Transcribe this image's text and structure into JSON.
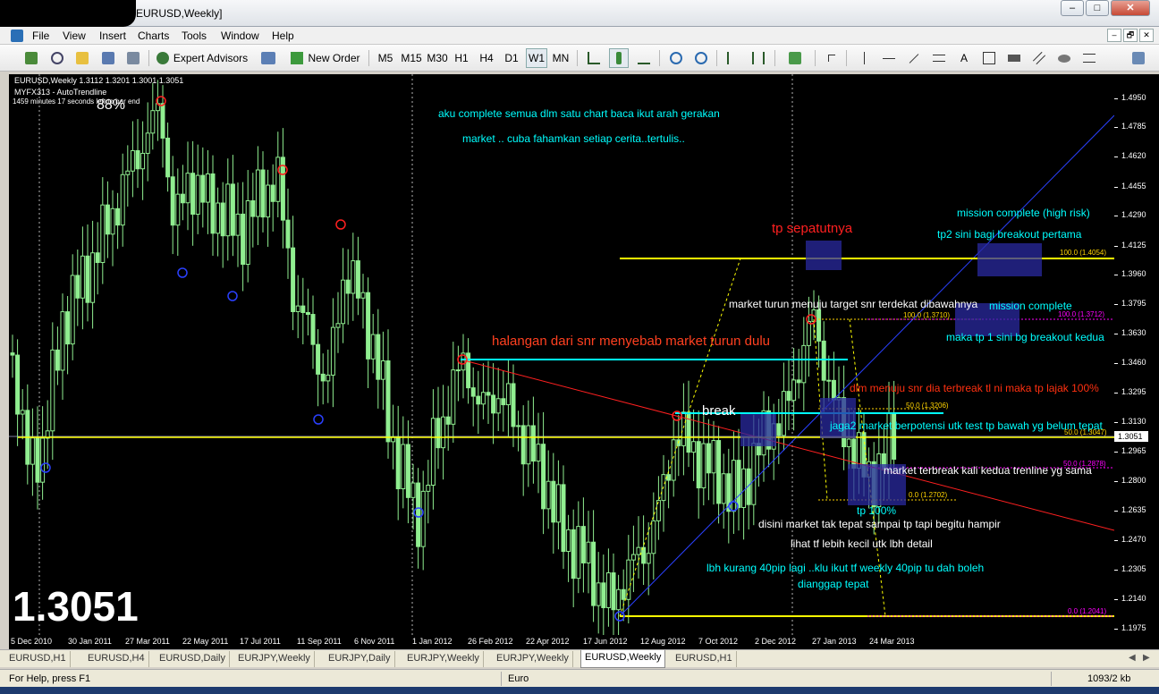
{
  "window": {
    "title": "EURUSD,Weekly]",
    "min": "–",
    "max": "□",
    "close": "✕"
  },
  "menu": {
    "items": [
      "File",
      "View",
      "Insert",
      "Charts",
      "Tools",
      "Window",
      "Help"
    ]
  },
  "mdi": {
    "min": "–",
    "restore": "🗗",
    "close": "✕"
  },
  "toolbar": {
    "expert_advisors": "Expert Advisors",
    "new_order": "New Order",
    "timeframes": [
      "M5",
      "M15",
      "M30",
      "H1",
      "H4",
      "D1",
      "W1",
      "MN"
    ],
    "active_timeframe": "W1",
    "text_tool": "A"
  },
  "chart": {
    "symbol_line": "EURUSD,Weekly  1.3112 1.3201 1.3001 1.3051",
    "indicator": "MYFX313 - AutoTrendline",
    "timer": "1459 minutes 17 seconds left to bar end",
    "percent": "88%",
    "big_price": "1.3051",
    "price_ticks": [
      "1.4950",
      "1.4785",
      "1.4620",
      "1.4455",
      "1.4290",
      "1.4125",
      "1.3960",
      "1.3795",
      "1.3630",
      "1.3460",
      "1.3295",
      "1.3130",
      "1.2965",
      "1.2800",
      "1.2635",
      "1.2470",
      "1.2305",
      "1.2140",
      "1.1975"
    ],
    "current_price": "1.3051",
    "time_ticks": [
      "5 Dec 2010",
      "30 Jan 2011",
      "27 Mar 2011",
      "22 May 2011",
      "17 Jul 2011",
      "11 Sep 2011",
      "6 Nov 2011",
      "1 Jan 2012",
      "26 Feb 2012",
      "22 Apr 2012",
      "17 Jun 2012",
      "12 Aug 2012",
      "7 Oct 2012",
      "2 Dec 2012",
      "27 Jan 2013",
      "24 Mar 2013"
    ],
    "fib_labels": {
      "f1_100": "100.0 (1.4054)",
      "f2_100": "100.0 (1.3710)",
      "f2_50": "50.0 (1.3206)",
      "f2_0": "0.0 (1.2702)",
      "f3_100": "100.0 (1.3712)",
      "f3_50": "50.0 (1.3047)",
      "f3_50b": "50.0 (1.2878)",
      "f3_0": "0.0 (1.2041)"
    },
    "annotations": {
      "a1": "aku complete semua dlm satu chart baca ikut arah gerakan",
      "a2": "market .. cuba fahamkan setiap cerita..tertulis..",
      "tp_sepatutnya": "tp sepatutnya",
      "mission_high": "mission complete (high risk)",
      "tp2": "tp2 sini bagi breakout pertama",
      "market_turun": "market turun menuju target snr terdekat dibawahnya",
      "mission": "mission complete",
      "halangan": "halangan dari snr menyebab market turun dulu",
      "maka_tp1": "maka tp 1 sini bg breakout kedua",
      "dlm_menuju": "dlm menuju snr dia terbreak tl ni maka tp lajak 100%",
      "break": "break",
      "jaga2": "jaga2 market berpotensi utk test tp bawah yg belum tepat",
      "terbreak2": "market terbreak kali kedua trenline yg sama",
      "tp100": "tp 100%",
      "disini": "disini market tak tepat sampai tp tapi begitu hampir",
      "lihat": "lihat tf lebih kecil utk lbh detail",
      "lbh1": "lbh kurang 40pip lagi ..klu ikut tf weekly 40pip tu dah boleh",
      "lbh2": "dianggap tepat"
    }
  },
  "tabs": {
    "items": [
      "EURUSD,H1",
      "EURUSD,H4",
      "EURUSD,Daily",
      "EURJPY,Weekly",
      "EURJPY,Daily",
      "EURJPY,Weekly",
      "EURJPY,Weekly",
      "EURUSD,Weekly",
      "EURUSD,H1"
    ],
    "active": "EURUSD,Weekly",
    "prev": "◀",
    "next": "▶"
  },
  "status": {
    "help": "For Help, press F1",
    "profile": "Euro",
    "traffic": "1093/2 kb"
  },
  "colors": {
    "bull": "#90ee90",
    "bear": "#90ee90",
    "cyan": "#00ffff",
    "yellow": "#ffff00",
    "red": "#ff0000",
    "blue": "#0000ff",
    "magenta": "#ff00ff",
    "fibyellow": "#ffd400"
  }
}
